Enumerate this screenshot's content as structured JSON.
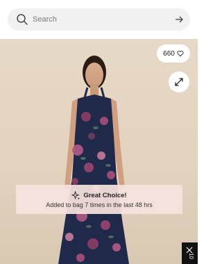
{
  "search": {
    "placeholder": "Search"
  },
  "product_image": {
    "likes_count": "660"
  },
  "toast": {
    "title": "Great Choice!",
    "message": "Added to bag 7 times in the last 48 hrs"
  },
  "side_tab": {
    "label": "10"
  },
  "icons": [
    "search-icon",
    "arrow-right-icon",
    "heart-icon",
    "expand-icon",
    "sparkle-icon",
    "close-icon"
  ],
  "colors": {
    "toast_bg": "#f6e2de",
    "photo_bg": "#e5d6c3",
    "dress": "#1f2a4a",
    "side_panel": "#111111"
  }
}
